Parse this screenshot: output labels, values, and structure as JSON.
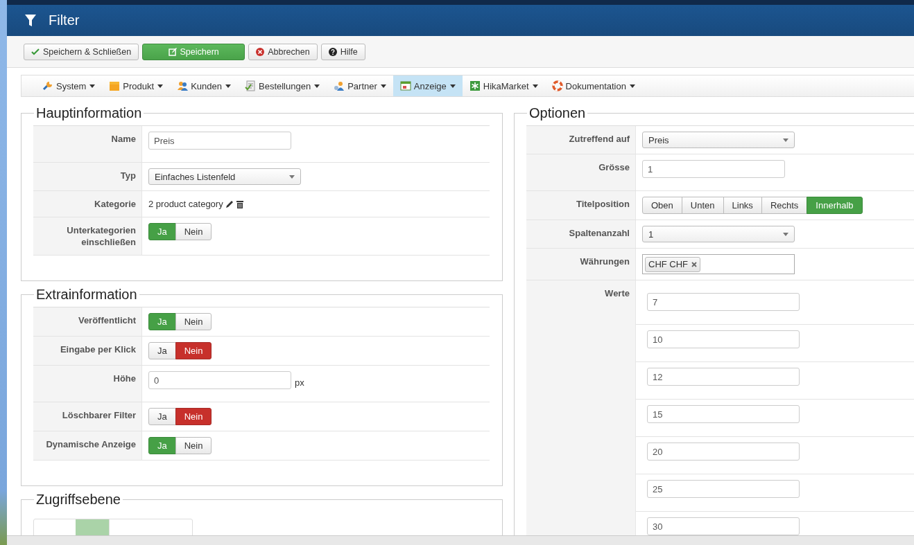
{
  "title": "Filter",
  "toolbar": [
    {
      "label": "Speichern & Schließen",
      "kind": "save-close"
    },
    {
      "label": "Speichern",
      "kind": "save"
    },
    {
      "label": "Abbrechen",
      "kind": "cancel"
    },
    {
      "label": "Hilfe",
      "kind": "help"
    }
  ],
  "menu": [
    {
      "label": "System",
      "selected": false
    },
    {
      "label": "Produkt",
      "selected": false
    },
    {
      "label": "Kunden",
      "selected": false
    },
    {
      "label": "Bestellungen",
      "selected": false
    },
    {
      "label": "Partner",
      "selected": false
    },
    {
      "label": "Anzeige",
      "selected": true
    },
    {
      "label": "HikaMarket",
      "selected": false
    },
    {
      "label": "Dokumentation",
      "selected": false
    }
  ],
  "main_info": {
    "legend": "Hauptinformation",
    "rows": [
      {
        "label": "Name",
        "kind": "text",
        "value": "Preis"
      },
      {
        "label": "Typ",
        "kind": "select",
        "value": "Einfaches Listenfeld"
      },
      {
        "label": "Kategorie",
        "kind": "category",
        "value": "2 product category"
      },
      {
        "label": "Unterkategorien einschließen",
        "kind": "toggle",
        "options": [
          {
            "label": "Ja",
            "selected": true
          },
          {
            "label": "Nein",
            "selected": false
          }
        ]
      }
    ]
  },
  "extra_info": {
    "legend": "Extrainformation",
    "rows": [
      {
        "label": "Veröffentlicht",
        "kind": "toggle",
        "options": [
          {
            "label": "Ja",
            "selected": true
          },
          {
            "label": "Nein",
            "selected": false
          }
        ]
      },
      {
        "label": "Eingabe per Klick",
        "kind": "toggle",
        "options": [
          {
            "label": "Ja",
            "selected": false
          },
          {
            "label": "Nein",
            "selected": true
          }
        ]
      },
      {
        "label": "Höhe",
        "kind": "text",
        "value": "0",
        "unit": "px"
      },
      {
        "label": "Löschbarer Filter",
        "kind": "toggle",
        "options": [
          {
            "label": "Ja",
            "selected": false
          },
          {
            "label": "Nein",
            "selected": true
          }
        ]
      },
      {
        "label": "Dynamische Anzeige",
        "kind": "toggle",
        "options": [
          {
            "label": "Ja",
            "selected": true
          },
          {
            "label": "Nein",
            "selected": false
          }
        ]
      }
    ]
  },
  "access": {
    "legend": "Zugriffsebene"
  },
  "options": {
    "legend": "Optionen",
    "rows": [
      {
        "label": "Zutreffend auf",
        "kind": "select",
        "value": "Preis"
      },
      {
        "label": "Grösse",
        "kind": "text",
        "value": "1"
      },
      {
        "label": "Titelposition",
        "kind": "segments",
        "options": [
          {
            "label": "Oben",
            "selected": false
          },
          {
            "label": "Unten",
            "selected": false
          },
          {
            "label": "Links",
            "selected": false
          },
          {
            "label": "Rechts",
            "selected": false
          },
          {
            "label": "Innerhalb",
            "selected": true
          }
        ]
      },
      {
        "label": "Spaltenanzahl",
        "kind": "select",
        "value": "1"
      },
      {
        "label": "Währungen",
        "kind": "tags",
        "tags": [
          "CHF CHF"
        ]
      },
      {
        "label": "Werte",
        "kind": "values",
        "values": [
          "7",
          "10",
          "12",
          "15",
          "20",
          "25",
          "30"
        ]
      }
    ]
  }
}
